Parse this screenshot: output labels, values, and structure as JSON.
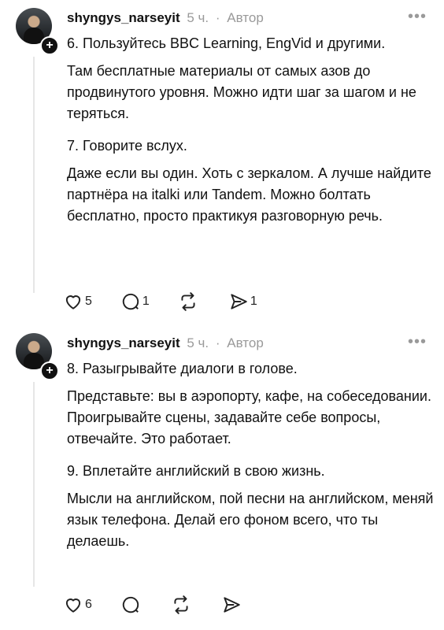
{
  "posts": [
    {
      "username": "shyngys_narseyit",
      "time": "5 ч.",
      "separator": "·",
      "role": "Автор",
      "paragraphs": [
        "6. Пользуйтесь BBC Learning, EngVid и другими.",
        "Там бесплатные материалы от самых азов до продвинутого уровня. Можно идти шаг за шагом и не теряться.",
        "7. Говорите вслух.",
        "Даже если вы один. Хоть с зеркалом. А лучше найдите партнёра на italki или Tandem. Можно болтать бесплатно, просто практикуя разговорную речь."
      ],
      "likes": "5",
      "replies": "1",
      "reposts": "",
      "shares": "1"
    },
    {
      "username": "shyngys_narseyit",
      "time": "5 ч.",
      "separator": "·",
      "role": "Автор",
      "paragraphs": [
        "8. Разыгрывайте диалоги в голове.",
        "Представьте: вы в аэропорту, кафе, на собеседовании. Проигрывайте сцены, задавайте себе вопросы, отвечайте. Это работает.",
        "9. Вплетайте английский в свою жизнь.",
        "Мысли на английском, пой песни на английском, меняй язык телефона. Делай его фоном всего, что ты делаешь."
      ],
      "likes": "6",
      "replies": "",
      "reposts": "",
      "shares": ""
    }
  ],
  "more_icon": "more-horizontal-icon",
  "icons": [
    "heart-icon",
    "comment-icon",
    "repost-icon",
    "share-icon"
  ]
}
